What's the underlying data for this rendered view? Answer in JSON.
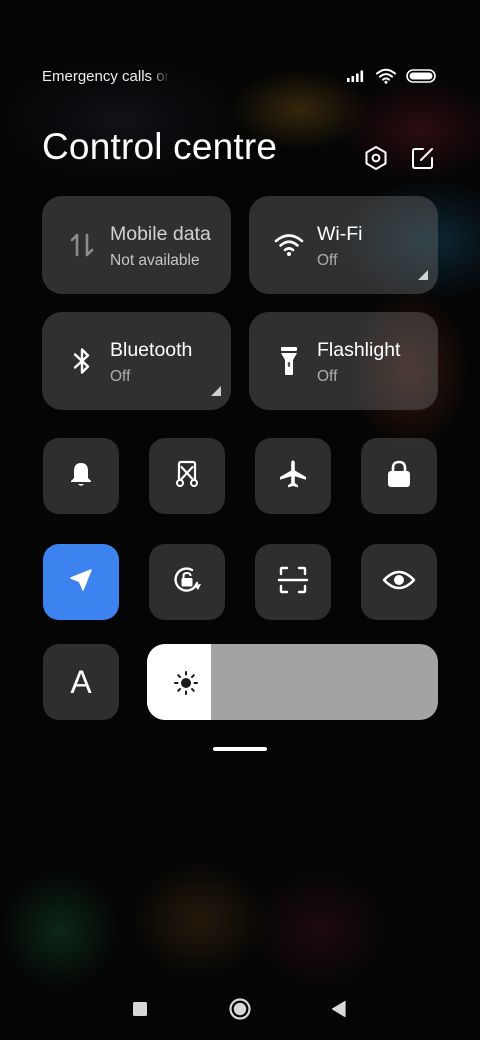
{
  "status_bar": {
    "carrier_text": "Emergency calls only",
    "icons": [
      "signal-icon",
      "wifi-icon",
      "battery-icon"
    ]
  },
  "header": {
    "title": "Control centre",
    "actions": [
      "settings-icon",
      "edit-icon"
    ]
  },
  "tiles": [
    {
      "label": "Mobile data",
      "status": "Not available",
      "icon": "mobile-data-icon",
      "enabled": false
    },
    {
      "label": "Wi-Fi",
      "status": "Off",
      "icon": "wifi-icon",
      "enabled": true
    },
    {
      "label": "Bluetooth",
      "status": "Off",
      "icon": "bluetooth-icon",
      "enabled": true
    },
    {
      "label": "Flashlight",
      "status": "Off",
      "icon": "flashlight-icon",
      "enabled": true
    }
  ],
  "small_toggles": [
    {
      "icon": "bell-icon",
      "active": false
    },
    {
      "icon": "screenshot-icon",
      "active": false
    },
    {
      "icon": "airplane-icon",
      "active": false
    },
    {
      "icon": "lock-icon",
      "active": false
    },
    {
      "icon": "location-icon",
      "active": true
    },
    {
      "icon": "rotation-lock-icon",
      "active": false
    },
    {
      "icon": "scanner-icon",
      "active": false
    },
    {
      "icon": "reading-mode-icon",
      "active": false
    },
    {
      "icon": "font-size-icon",
      "active": false
    }
  ],
  "font_toggle_label": "A",
  "brightness": {
    "level": 0.22,
    "icon": "sun-icon"
  },
  "nav_bar": {
    "buttons": [
      "recents-icon",
      "home-icon",
      "back-icon"
    ]
  },
  "colors": {
    "accent": "#3d83f0",
    "tile_bg": "#5e5e5e",
    "background": "#050505"
  }
}
